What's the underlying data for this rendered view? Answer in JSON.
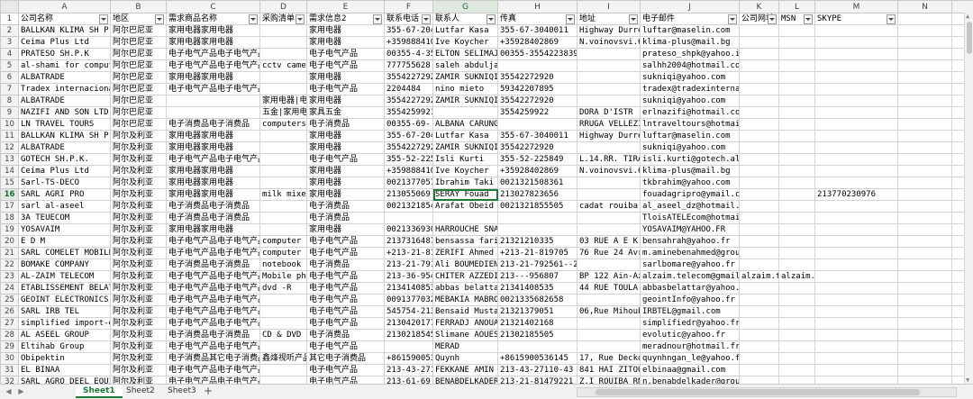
{
  "columns": [
    "A",
    "B",
    "C",
    "D",
    "E",
    "F",
    "G",
    "H",
    "I",
    "J",
    "K",
    "L",
    "M",
    "N",
    "O",
    "P"
  ],
  "header_row": [
    "公司名称",
    "地区",
    "需求商品名称",
    "采购清单",
    "需求信息2",
    "联系电话",
    "联系人",
    "传真",
    "地址",
    "电子邮件",
    "公司网址",
    "MSN",
    "SKYPE",
    "",
    "",
    ""
  ],
  "filter_columns": [
    0,
    1,
    2,
    3,
    4,
    5,
    6,
    7,
    8,
    9,
    10,
    11,
    12
  ],
  "rows": [
    {
      "n": "2",
      "c": [
        "BALLKAN KLIMA SH P K",
        "阿尔巴尼亚",
        "家用电器家用电器",
        "",
        "家用电器",
        "355-67-204",
        "Lutfar Kasa",
        "355-67-3040011",
        "Highway Durres",
        "luftar@maselin.com",
        "",
        "",
        "",
        "",
        "",
        ""
      ]
    },
    {
      "n": "3",
      "c": [
        "Ceima Plus Ltd",
        "阿尔巴尼亚",
        "家用电器家用电器",
        "",
        "家用电器",
        "+359888410",
        "Ive Koycher",
        "+35928402869",
        "N.voinovsvi.61",
        "klima-plus@mail.bg",
        "",
        "",
        "",
        "",
        "",
        ""
      ]
    },
    {
      "n": "4",
      "c": [
        "PRATESO SH.P.K",
        "阿尔巴尼亚",
        "电子电气产品电子电气产品",
        "",
        "电子电气产品",
        "00355-4-35",
        "ELTON SELIMAJ",
        "00355-35542238398",
        "",
        "prateso_shpk@yahoo.it",
        "",
        "",
        "",
        "",
        "",
        ""
      ]
    },
    {
      "n": "5",
      "c": [
        "al-shami for computer",
        "阿尔巴尼亚",
        "电子电气产品电子电气产品",
        "cctv camer",
        "电子电气产品",
        "777755628",
        "saleh abduljabar",
        "",
        "",
        "salhh2004@hotmail.com",
        "",
        "",
        "",
        "",
        "",
        ""
      ]
    },
    {
      "n": "6",
      "c": [
        "ALBATRADE",
        "阿尔巴尼亚",
        "家用电器家用电器",
        "",
        "家用电器",
        "35542272920",
        "ZAMIR SUKNIQI",
        "35542272920",
        "",
        "sukniqi@yahoo.com",
        "",
        "",
        "",
        "",
        "",
        ""
      ]
    },
    {
      "n": "7",
      "c": [
        "Tradex internacional",
        "阿尔巴尼亚",
        "电子电气产品电子电气产品",
        "",
        "电子电气产品",
        "2204484",
        "nino mieto",
        "59342207895",
        "",
        "tradex@tradexinternacional.com",
        "",
        "",
        "",
        "",
        "",
        ""
      ]
    },
    {
      "n": "8",
      "c": [
        "ALBATRADE",
        "阿尔巴尼亚",
        "",
        "家用电器|电子电气产品|办公文",
        "家用电器",
        "35542272920",
        "ZAMIR SUKNIQI",
        "35542272920",
        "",
        "sukniqi@yahoo.com",
        "",
        "",
        "",
        "",
        "",
        ""
      ]
    },
    {
      "n": "9",
      "c": [
        "NAZIFI AND SON LTD.",
        "阿尔巴尼亚",
        "",
        "五金|家用电器|建筑及装饰材料",
        "家具五金",
        "3554259921",
        "",
        "3554259922",
        "DORA D'ISTR",
        "erlnazifi@hotmail.com",
        "",
        "",
        "",
        "",
        "",
        ""
      ]
    },
    {
      "n": "10",
      "c": [
        "LN TRAVEL TOURS",
        "阿尔巴尼亚",
        "电子消费品电子消费品",
        "computers",
        "电子消费品",
        "00355-69-",
        "ALBANA CARUNGU",
        "",
        "RRUGA VELLEZI",
        "lntraveltours@hotmail.com",
        "",
        "",
        "",
        "",
        "",
        ""
      ]
    },
    {
      "n": "11",
      "c": [
        "BALLKAN KLIMA SH P K",
        "阿尔及利亚",
        "家用电器家用电器",
        "",
        "家用电器",
        "355-67-204",
        "Lutfar Kasa",
        "355-67-3040011",
        "Highway Durres",
        "luftar@maselin.com",
        "",
        "",
        "",
        "",
        "",
        ""
      ]
    },
    {
      "n": "12",
      "c": [
        "ALBATRADE",
        "阿尔及利亚",
        "家用电器家用电器",
        "",
        "家用电器",
        "35542272920",
        "ZAMIR SUKNIQI",
        "35542272920",
        "",
        "sukniqi@yahoo.com",
        "",
        "",
        "",
        "",
        "",
        ""
      ]
    },
    {
      "n": "13",
      "c": [
        "GOTECH SH.P.K.",
        "阿尔及利亚",
        "电子电气产品电子电气产品",
        "",
        "电子电气产品",
        "355-52-225",
        "Isli Kurti",
        "355-52-225849",
        "L.14.RR. TIRAN",
        "isli.kurti@gotech.al",
        "",
        "",
        "",
        "",
        "",
        ""
      ]
    },
    {
      "n": "14",
      "c": [
        "Ceima Plus Ltd",
        "阿尔及利亚",
        "家用电器家用电器",
        "",
        "家用电器",
        "+359888410",
        "Ive Koycher",
        "+35928402869",
        "N.voinovsvi.61",
        "klima-plus@mail.bg",
        "",
        "",
        "",
        "",
        "",
        ""
      ]
    },
    {
      "n": "15",
      "c": [
        "Sarl-TS-DECO",
        "阿尔及利亚",
        "家用电器家用电器",
        "",
        "家用电器",
        "0021377057",
        "Ibrahim Taki",
        "0021321508361",
        "",
        "tkbrahim@yahoo.com",
        "",
        "",
        "",
        "",
        "",
        ""
      ]
    },
    {
      "n": "16",
      "c": [
        "SARL AGRI PRO",
        "阿尔及利亚",
        "家用电器家用电器",
        "milk mixer",
        "家用电器",
        "213055069",
        "SERAY Fouad",
        "213027823656",
        "",
        "fouadagripro@ymail.com",
        "",
        "",
        "213770230976",
        "",
        "",
        ""
      ]
    },
    {
      "n": "17",
      "c": [
        "sarl al-aseel",
        "阿尔及利亚",
        "电子消费品电子消费品",
        "",
        "电子消费品",
        "0021321854",
        "Arafat Obeid",
        "0021321855505",
        "cadat rouiba",
        "al_aseel_dz@hotmail.com",
        "",
        "",
        "",
        "",
        "",
        ""
      ]
    },
    {
      "n": "18",
      "c": [
        "3A TEUECOM",
        "阿尔及利亚",
        "电子消费品电子消费品",
        "",
        "电子消费品",
        "",
        "",
        "",
        "",
        "TloisATELEcom@hotmail.com",
        "",
        "",
        "",
        "",
        "",
        ""
      ]
    },
    {
      "n": "19",
      "c": [
        "YOSAVAIM",
        "阿尔及利亚",
        "家用电器家用电器",
        "",
        "家用电器",
        "0021336930",
        "HARROUCHE SNAIL",
        "",
        "",
        "YOSAVAIM@YAHOO.FR",
        "",
        "",
        "",
        "",
        "",
        ""
      ]
    },
    {
      "n": "20",
      "c": [
        "E D M",
        "阿尔及利亚",
        "电子电气产品电子电气产品",
        "computer a",
        "电子电气产品",
        "2137316487",
        "bensassa farid",
        "21321210335",
        "03 RUE A E K A",
        "bensahrah@yahoo.fr",
        "",
        "",
        "",
        "",
        "",
        ""
      ]
    },
    {
      "n": "21",
      "c": [
        "SARL COMELET MOBILE",
        "阿尔及利亚",
        "电子电气产品电子电气产品",
        "computer a",
        "电子电气产品",
        "+213-21-81",
        "ZERIFI Ahmed",
        "+213-21-819705",
        "76 Rue 24 Avril",
        "m.aminebenahmed@groupebenahmed-dz.com",
        "",
        "",
        "",
        "",
        "",
        ""
      ]
    },
    {
      "n": "22",
      "c": [
        "BOMAKE COMPANY",
        "阿尔及利亚",
        "电子消费品电子消费品",
        "notebook c",
        "电子消费品",
        "213-21-791",
        "Ali BOUMEDIENE",
        "213-21-792561--21",
        "",
        "sarlbomare@yahoo.fr",
        "",
        "",
        "",
        "",
        "",
        ""
      ]
    },
    {
      "n": "23",
      "c": [
        "AL-ZAIM TELECOM",
        "阿尔及利亚",
        "电子电气产品电子电气产品",
        "Mobile pho",
        "电子电气产品",
        "213-36-954",
        "CHITER AZZEDINE",
        "213---956807",
        "BP 122 Ain-Aze",
        "alzaim.telecom@gmail.com",
        "alzaim.tel",
        "alzaim.telecom",
        "",
        "",
        "",
        ""
      ]
    },
    {
      "n": "24",
      "c": [
        "ETABLISSEMENT BELATTA",
        "阿尔及利亚",
        "电子电气产品电子电气产品",
        "dvd -R",
        "电子电气产品",
        "2134140853",
        "abbas belattar",
        "21341408535",
        "44 RUE TOULA A",
        "abbasbelattar@yahoo.fr",
        "",
        "",
        "",
        "",
        "",
        ""
      ]
    },
    {
      "n": "25",
      "c": [
        "GEOINT ELECTRONICS",
        "阿尔及利亚",
        "电子电气产品电子电气产品",
        "",
        "电子电气产品",
        "0091377032",
        "MEBAKIA MABROUK",
        "0021335682658",
        "",
        "geointInfo@yahoo.fr",
        "",
        "",
        "",
        "",
        "",
        ""
      ]
    },
    {
      "n": "26",
      "c": [
        "SARL IRB TEL",
        "阿尔及利亚",
        "电子电气产品电子电气产品",
        "",
        "电子电气产品",
        "545754-213",
        "Bensaid Mustaph",
        "21321379051",
        "06,Rue Mihoubi",
        "IRBTEL@gmail.com",
        "",
        "",
        "",
        "",
        "",
        ""
      ]
    },
    {
      "n": "27",
      "c": [
        "simplified import-exp",
        "阿尔及利亚",
        "电子电气产品电子电气产品",
        "",
        "电子电气产品",
        "2130420177",
        "FERRADJ ANOUAR",
        "21321402168",
        "",
        "simplifiedr@yahoo.fr",
        "",
        "",
        "",
        "",
        "",
        ""
      ]
    },
    {
      "n": "28",
      "c": [
        "AL ASEEL GROUP",
        "阿尔及利亚",
        "电子消费品电子消费品",
        "CD & DVD",
        "电子消费品",
        "2130218545",
        "Slimane AOUES",
        "21302185505",
        "",
        "evolutic@yahoo.fr",
        "",
        "",
        "",
        "",
        "",
        ""
      ]
    },
    {
      "n": "29",
      "c": [
        "Eltihab Group",
        "阿尔及利亚",
        "电子电气产品电子电气产品",
        "",
        "电子电气产品",
        "",
        "MERAD",
        "",
        "",
        "meradnour@hotmail.fr",
        "",
        "",
        "",
        "",
        "",
        ""
      ]
    },
    {
      "n": "30",
      "c": [
        "Obipektin",
        "阿尔及利亚",
        "电子消费品其它电子消费品",
        "鑫烽视听产品",
        "其它电子消费品",
        "+861590053",
        "Quynh",
        "+8615900536145",
        "17, Rue Deckdo",
        "quynhngan_le@yahoo.fr",
        "",
        "",
        "",
        "",
        "",
        ""
      ]
    },
    {
      "n": "31",
      "c": [
        "EL BINAA",
        "阿尔及利亚",
        "电子电气产品电子电气产品",
        "",
        "电子电气产品",
        "213-43-271",
        "FEKKANE AMIN",
        "213-43-27110-43",
        "841 HAI ZITOUN",
        "elbinaa@gmail.com",
        "",
        "",
        "",
        "",
        "",
        ""
      ]
    },
    {
      "n": "32",
      "c": [
        "SARL AGRO DEEL EQUIPE",
        "阿尔及利亚",
        "电子电气产品电子电气产品",
        "",
        "电子电气产品",
        "213-61-69",
        "BENABDELKADER N",
        "213-21-81479221",
        "Z.I ROUIBA RN",
        "n.benabdelkader@groupekherbouche.com",
        "",
        "",
        "",
        "",
        "",
        ""
      ]
    }
  ],
  "active_cell": "G16",
  "sheet_tabs": [
    "Sheet1",
    "Sheet2",
    "Sheet3"
  ],
  "active_tab": "Sheet1",
  "add_tab_label": "+",
  "nav_arrows": [
    "◀",
    "▶"
  ],
  "scroll_arrows": [
    "◀",
    "▶",
    "▲",
    "▼"
  ]
}
